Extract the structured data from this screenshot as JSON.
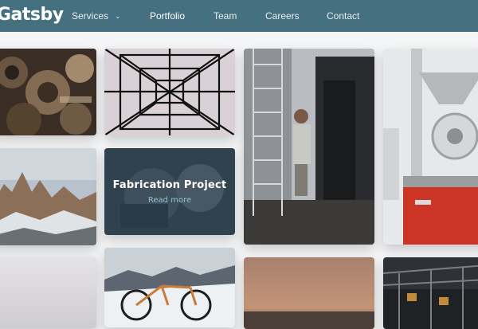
{
  "header": {
    "logo": "Gatsby",
    "nav": [
      {
        "label": "Services",
        "has_dropdown": true
      },
      {
        "label": "Portfolio",
        "active": true
      },
      {
        "label": "Team"
      },
      {
        "label": "Careers"
      },
      {
        "label": "Contact"
      }
    ],
    "bg_color": "#45707f"
  },
  "portfolio": {
    "featured_card": {
      "title": "Fabrication Project",
      "link_text": "Read more"
    },
    "cards": [
      {
        "subject": "engine gears"
      },
      {
        "subject": "steel tower lattice"
      },
      {
        "subject": "man working on building"
      },
      {
        "subject": "coffee roaster"
      },
      {
        "subject": "mountain range"
      },
      {
        "subject": "fabrication project"
      },
      {
        "subject": "foggy sky"
      },
      {
        "subject": "bicycle in snow"
      },
      {
        "subject": "sea at dusk"
      },
      {
        "subject": "industrial bridge"
      }
    ]
  }
}
